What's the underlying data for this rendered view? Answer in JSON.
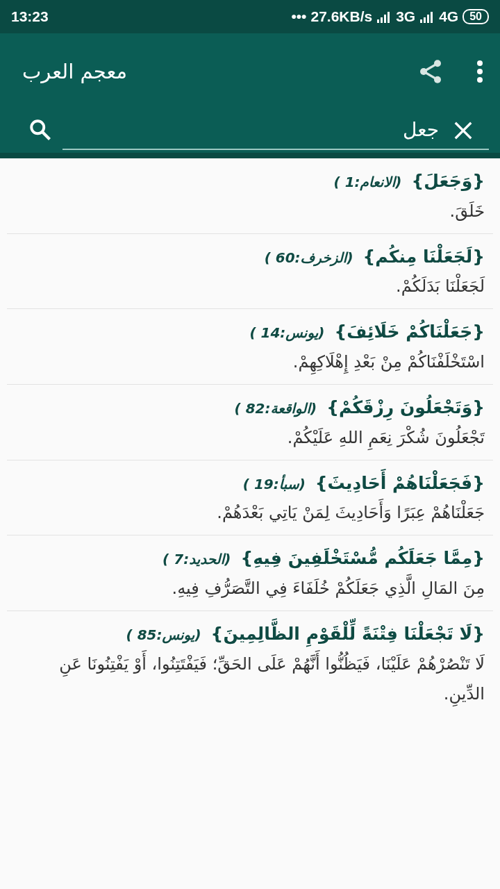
{
  "status_bar": {
    "time": "13:23",
    "dots": "•••",
    "speed": "27.6KB/s",
    "network_1": "3G",
    "network_2": "4G",
    "battery": "50"
  },
  "app_bar": {
    "title": "معجم العرب"
  },
  "search": {
    "value": "جعل"
  },
  "entries": [
    {
      "phrase": "{وَجَعَلَ}",
      "reference": "(الانعام:1 )",
      "meaning": "خَلَقَ."
    },
    {
      "phrase": "{لَجَعَلْنَا مِنكُم}",
      "reference": "(الزخرف:60 )",
      "meaning": "لَجَعَلْنَا بَدَلَكُمْ."
    },
    {
      "phrase": "{جَعَلْنَاكُمْ خَلَائِفَ}",
      "reference": "(يونس:14 )",
      "meaning": "اسْتَخْلَفْنَاكُمْ مِنْ بَعْدِ إِهْلَاكِهِمْ."
    },
    {
      "phrase": "{وَتَجْعَلُونَ رِزْقَكُمْ}",
      "reference": "(الواقعة:82 )",
      "meaning": "تَجْعَلُونَ شُكْرَ نِعَمِ اللهِ عَلَيْكُمْ."
    },
    {
      "phrase": "{فَجَعَلْنَاهُمْ أَحَادِيثَ}",
      "reference": "(سبأ:19 )",
      "meaning": "جَعَلْنَاهُمْ عِبَرًا وَأَحَادِيثَ لِمَنْ يَاتِي بَعْدَهُمْ."
    },
    {
      "phrase": "{مِمَّا جَعَلَكُم مُّسْتَخْلَفِينَ فِيهِ}",
      "reference": "(الحديد:7 )",
      "meaning": "مِنَ المَالِ الَّذِي جَعَلَكُمْ خُلَفَاءَ فِي التَّصَرُّفِ فِيهِ."
    },
    {
      "phrase": "{لَا تَجْعَلْنَا فِتْنَةً لِّلْقَوْمِ الظَّالِمِينَ}",
      "reference": "(يونس:85 )",
      "meaning": "لَا تَنْصُرْهُمْ عَلَيْنَا، فَيَظُنُّوا أَنَّهُمْ عَلَى الحَقِّ؛ فَيَفْتَتِنُوا، أَوْ يَفْتِنُونَا عَنِ الدِّينِ."
    }
  ]
}
